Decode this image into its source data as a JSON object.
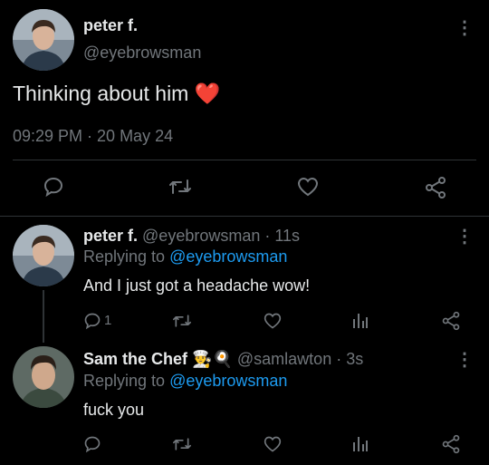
{
  "main_tweet": {
    "name": "peter f.",
    "handle": "@eyebrowsman",
    "text": "Thinking about him",
    "emoji": "❤️",
    "timestamp": "09:29 PM · 20 May 24",
    "menu": "⋮"
  },
  "replies": [
    {
      "name": "peter f.",
      "handle": "@eyebrowsman",
      "time": "· 11s",
      "replying_prefix": "Replying to",
      "replying_handle": "@eyebrowsman",
      "text": "And I just got a headache wow!",
      "reply_count": "1",
      "menu": "⋮"
    },
    {
      "name": "Sam the Chef",
      "name_emojis": "👨‍🍳🍳",
      "handle": "@samlawton",
      "time": "· 3s",
      "replying_prefix": "Replying to",
      "replying_handle": "@eyebrowsman",
      "text": "fuck you",
      "menu": "⋮"
    }
  ],
  "colors": {
    "background": "#000000",
    "text": "#e7e9ea",
    "secondary": "#71767b",
    "link": "#1d9bf0",
    "divider": "#2f3336"
  }
}
